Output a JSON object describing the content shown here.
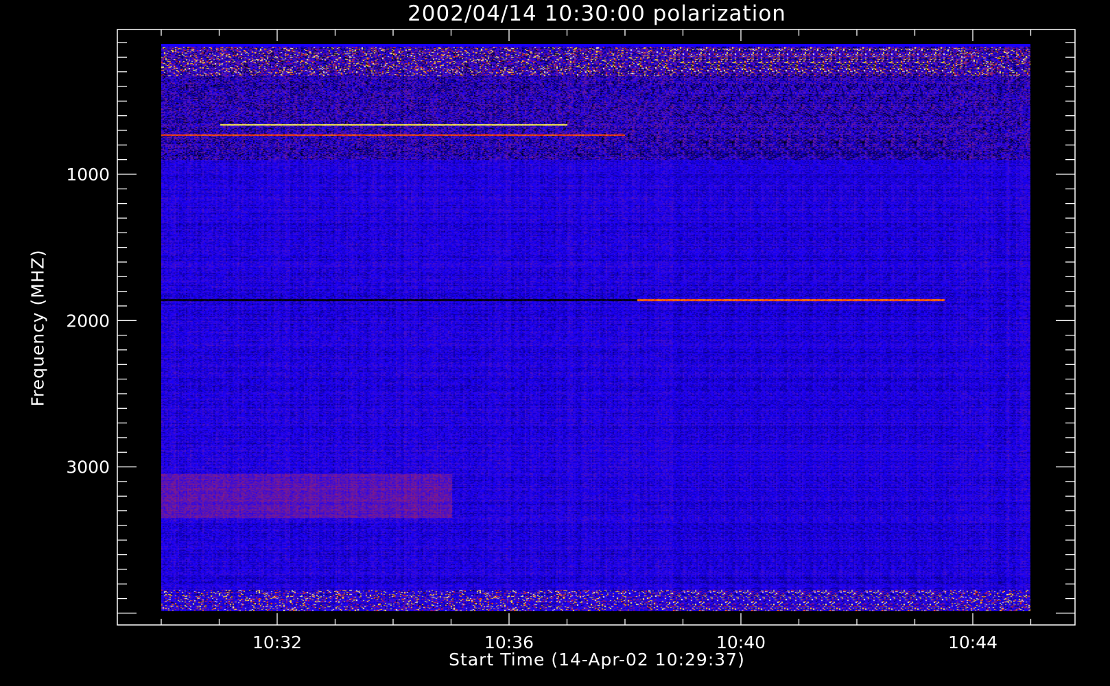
{
  "chart_data": {
    "type": "heatmap",
    "title": "2002/04/14 10:30:00 polarization",
    "xlabel": "Start Time (14-Apr-02 10:29:37)",
    "ylabel": "Frequency (MHZ)",
    "x_range_minutes": [
      "10:30",
      "10:45"
    ],
    "y_range_mhz": [
      110,
      3990
    ],
    "y_axis_inverted": true,
    "x_ticks": [
      {
        "label": "10:32",
        "minutes": 2
      },
      {
        "label": "10:36",
        "minutes": 6
      },
      {
        "label": "10:40",
        "minutes": 10
      },
      {
        "label": "10:44",
        "minutes": 14
      }
    ],
    "y_ticks": [
      {
        "label": "1000",
        "mhz": 1000
      },
      {
        "label": "2000",
        "mhz": 2000
      },
      {
        "label": "3000",
        "mhz": 3000
      }
    ],
    "colorscale": [
      "#000000",
      "#1800ff",
      "#6a1aa0",
      "#ff1800",
      "#ffb000",
      "#ffff40",
      "#ffffff"
    ],
    "background_level": 0.18,
    "features": [
      {
        "name": "rfi-band-top",
        "mhz": [
          130,
          330
        ],
        "minutes": [
          0,
          15
        ],
        "level": 0.5
      },
      {
        "name": "yellow-line",
        "mhz": [
          655,
          665
        ],
        "minutes": [
          1,
          7
        ],
        "level": 0.85
      },
      {
        "name": "red-line",
        "mhz": [
          725,
          735
        ],
        "minutes": [
          0,
          8
        ],
        "level": 0.6
      },
      {
        "name": "black-line",
        "mhz": [
          1855,
          1865
        ],
        "minutes": [
          0,
          8.2
        ],
        "level": 0.0
      },
      {
        "name": "red-burst-line",
        "mhz": [
          1855,
          1865
        ],
        "minutes": [
          8.2,
          13.5
        ],
        "level": 0.62
      },
      {
        "name": "reddish-patch",
        "mhz": [
          3050,
          3350
        ],
        "minutes": [
          0,
          5
        ],
        "level": 0.3
      },
      {
        "name": "rfi-band-bottom",
        "mhz": [
          3840,
          3990
        ],
        "minutes": [
          0,
          15
        ],
        "level": 0.5
      }
    ]
  }
}
